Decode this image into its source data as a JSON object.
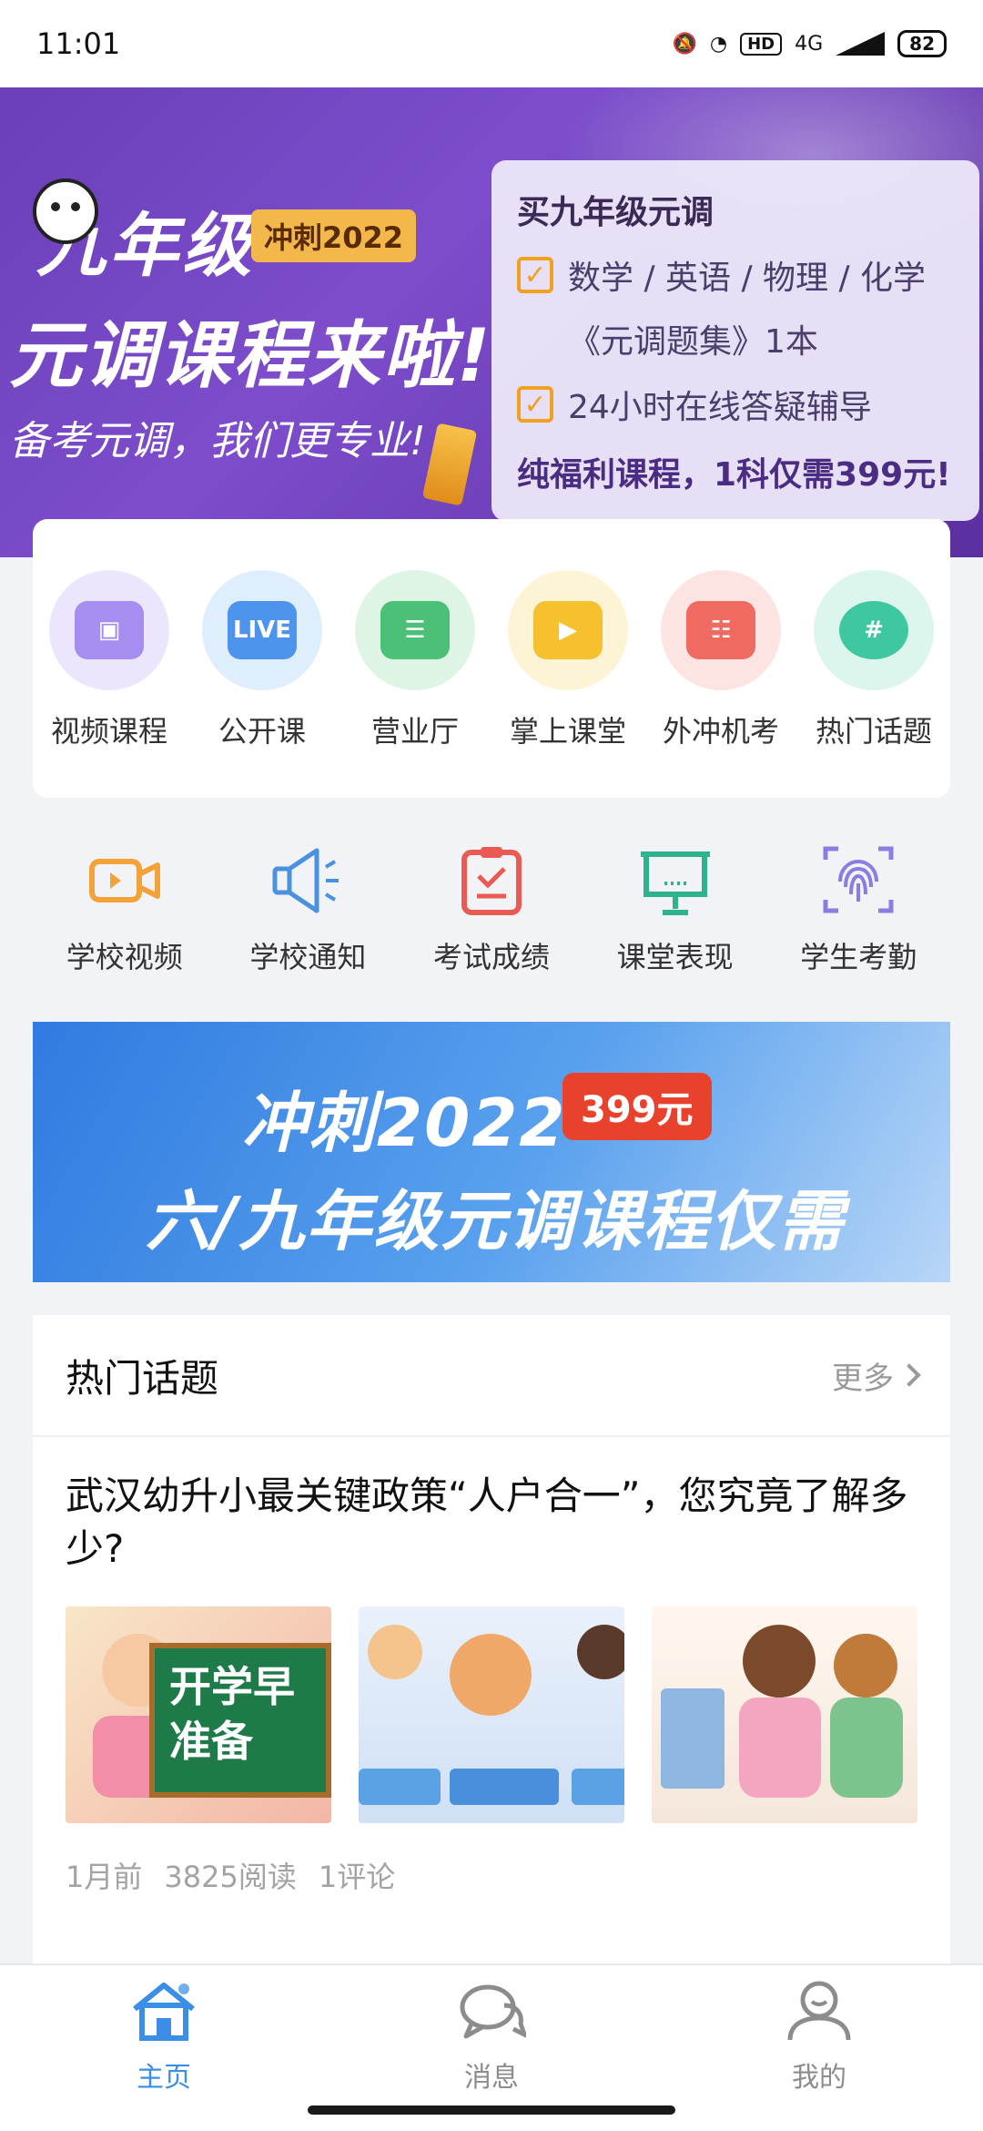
{
  "status_bar": {
    "time": "11:01",
    "network": "4G",
    "hd_label": "HD",
    "battery": "82"
  },
  "hero": {
    "grade_title": "九年级",
    "tag": "冲刺2022",
    "headline": "元调课程来啦!",
    "slogan": "备考元调，我们更专业!",
    "card_title": "买九年级元调",
    "card_items": [
      "数学 / 英语 / 物理 / 化学",
      "《元调题集》1本",
      "24小时在线答疑辅导"
    ],
    "card_footer": "纯福利课程，1科仅需399元!"
  },
  "quick_links": [
    {
      "label": "视频课程",
      "icon": "video-course-icon",
      "color": "#a68ef0",
      "bg": "#ece6fd"
    },
    {
      "label": "公开课",
      "icon": "live-icon",
      "color": "#4f94ec",
      "bg": "#dfeefc"
    },
    {
      "label": "营业厅",
      "icon": "clipboard-icon",
      "color": "#4cc076",
      "bg": "#def5e6"
    },
    {
      "label": "掌上课堂",
      "icon": "play-screen-icon",
      "color": "#f5c12c",
      "bg": "#fdf4d5"
    },
    {
      "label": "外冲机考",
      "icon": "exam-screen-icon",
      "color": "#ef6a60",
      "bg": "#fde3e1"
    },
    {
      "label": "热门话题",
      "icon": "hashtag-icon",
      "color": "#3ec7a0",
      "bg": "#dcf6ee"
    }
  ],
  "school_features": [
    {
      "label": "学校视频",
      "icon": "video-camera-icon",
      "color": "#f3a23a"
    },
    {
      "label": "学校通知",
      "icon": "megaphone-icon",
      "color": "#4a92e0"
    },
    {
      "label": "考试成绩",
      "icon": "score-clipboard-icon",
      "color": "#e85a52"
    },
    {
      "label": "课堂表现",
      "icon": "presentation-board-icon",
      "color": "#2fb38e"
    },
    {
      "label": "学生考勤",
      "icon": "fingerprint-icon",
      "color": "#8a7ce0"
    }
  ],
  "promo": {
    "line1": "冲刺2022",
    "price": "399元",
    "line2": "六/九年级元调课程仅需"
  },
  "topics": {
    "title": "热门话题",
    "more": "更多",
    "article": {
      "title": "武汉幼升小最关键政策“人户合一”，您究竟了解多少?",
      "board_text": "开学早准备",
      "time": "1月前",
      "reads": "3825阅读",
      "comments": "1评论"
    }
  },
  "tabbar": {
    "tabs": [
      {
        "label": "主页",
        "icon": "home-icon",
        "active": true
      },
      {
        "label": "消息",
        "icon": "chat-bubble-icon",
        "active": false
      },
      {
        "label": "我的",
        "icon": "profile-icon",
        "active": false
      }
    ]
  }
}
